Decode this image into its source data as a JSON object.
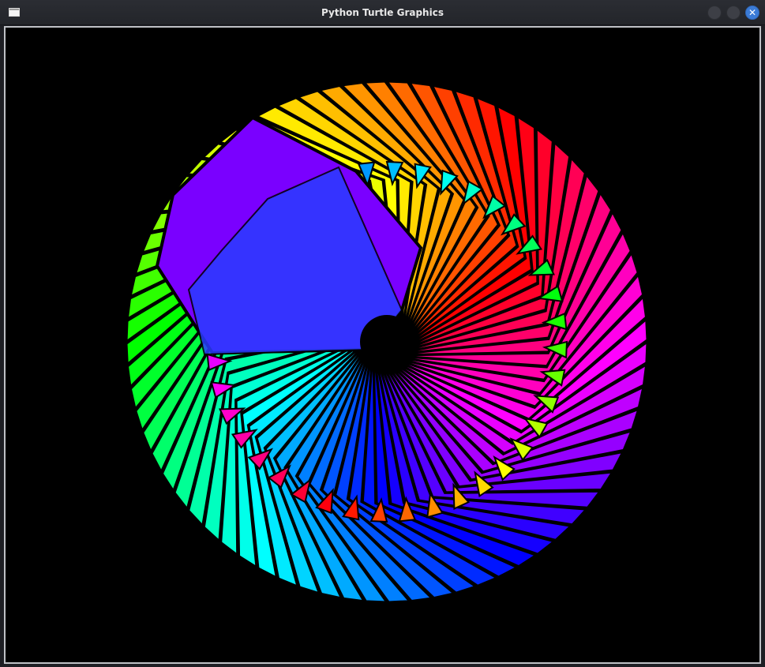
{
  "window": {
    "title": "Python Turtle Graphics",
    "app_icon": "window-icon",
    "buttons": [
      {
        "name": "minimize",
        "icon": "minimize-icon"
      },
      {
        "name": "maximize",
        "icon": "maximize-icon"
      },
      {
        "name": "close",
        "icon": "close-icon",
        "glyph": "✕",
        "color": "#3b7bd6"
      }
    ]
  },
  "canvas": {
    "background": "#000000",
    "drawing": "rainbow-spiral-pinwheel",
    "outer_spokes": 72,
    "inner_spokes": 40
  }
}
